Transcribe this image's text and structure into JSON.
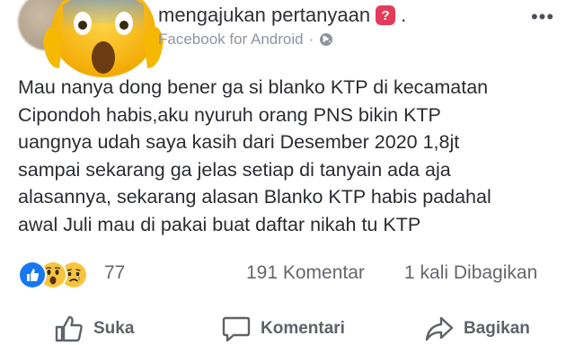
{
  "header": {
    "author_suffix": "mengajukan pertanyaan",
    "trailing_dot": ".",
    "question_badge": "?",
    "source": "Facebook for Android",
    "separator": "·",
    "privacy_icon": "globe-icon",
    "more_label": "•••"
  },
  "post": {
    "lines": [
      "Mau nanya dong bener ga si blanko KTP di kecamatan",
      "Cipondoh habis,aku nyuruh orang PNS bikin KTP",
      "uangnya udah saya kasih dari Desember 2020 1,8jt",
      "sampai sekarang ga jelas setiap di tanyain ada aja",
      "alasannya, sekarang alasan Blanko KTP habis padahal",
      "awal Juli mau di pakai buat daftar nikah tu KTP"
    ]
  },
  "stats": {
    "reactions": [
      "like-icon",
      "wow-icon",
      "sad-icon"
    ],
    "reaction_count": "77",
    "comments": "191 Komentar",
    "shares": "1 kali Dibagikan"
  },
  "actions": {
    "like": "Suka",
    "comment": "Komentari",
    "share": "Bagikan"
  },
  "colors": {
    "text": "#2a2c30",
    "meta": "#90949c",
    "like_blue": "#1877f2",
    "reaction_yellow": "#f7c43d",
    "badge_red": "#e43b59"
  }
}
